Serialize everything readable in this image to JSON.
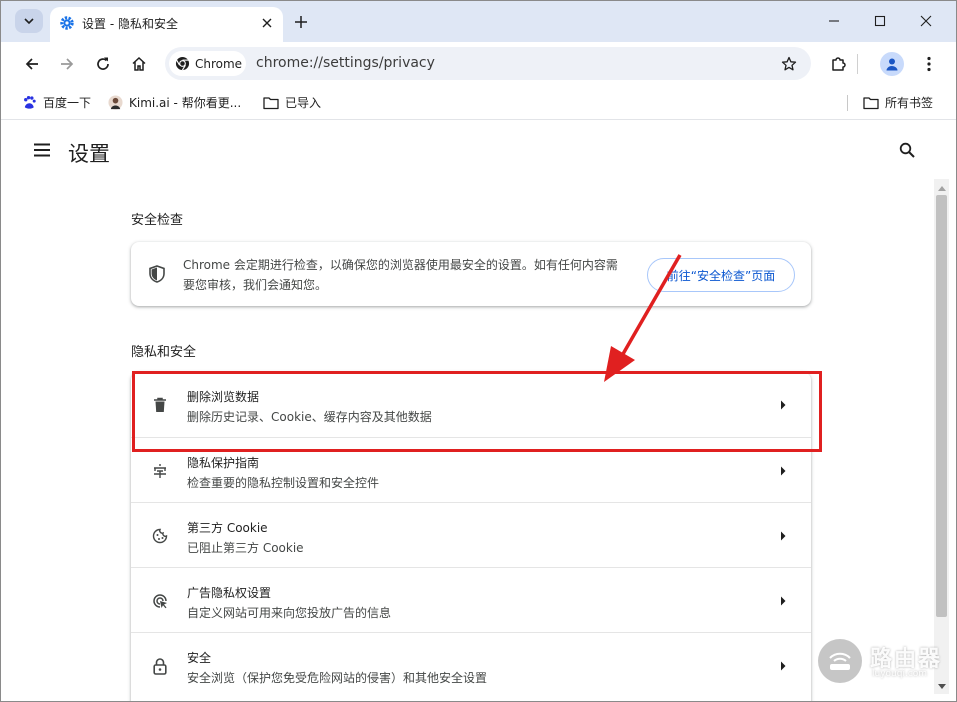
{
  "colors": {
    "tabstrip": "#dfe7f5",
    "accent": "#0b57d0",
    "annotation": "#e02020",
    "omnibox": "#eef1f7"
  },
  "tab": {
    "title": "设置 - 隐私和安全",
    "favicon": "gear-icon"
  },
  "toolbar": {
    "chip_label": "Chrome",
    "url": "chrome://settings/privacy"
  },
  "bookmarks": {
    "items": [
      {
        "label": "百度一下",
        "icon": "baidu-paw-icon"
      },
      {
        "label": "Kimi.ai - 帮你看更...",
        "icon": "kimi-avatar-icon"
      },
      {
        "label": "已导入",
        "icon": "folder-icon"
      }
    ],
    "all_bookmarks": "所有书签"
  },
  "settings": {
    "title": "设置"
  },
  "safety_check": {
    "section_title": "安全检查",
    "text": "Chrome 会定期进行检查，以确保您的浏览器使用最安全的设置。如有任何内容需要您审核，我们会通知您。",
    "button": "前往“安全检查”页面"
  },
  "privacy": {
    "section_title": "隐私和安全",
    "rows": [
      {
        "title": "删除浏览数据",
        "subtitle": "删除历史记录、Cookie、缓存内容及其他数据",
        "icon": "trash-icon"
      },
      {
        "title": "隐私保护指南",
        "subtitle": "检查重要的隐私控制设置和安全控件",
        "icon": "privacy-guide-icon"
      },
      {
        "title": "第三方 Cookie",
        "subtitle": "已阻止第三方 Cookie",
        "icon": "cookie-icon"
      },
      {
        "title": "广告隐私权设置",
        "subtitle": "自定义网站可用来向您投放广告的信息",
        "icon": "ad-privacy-icon"
      },
      {
        "title": "安全",
        "subtitle": "安全浏览（保护您免受危险网站的侵害）和其他安全设置",
        "icon": "lock-icon"
      }
    ]
  },
  "watermark": {
    "title": "路由器",
    "subtitle": "luyouqi.com"
  }
}
